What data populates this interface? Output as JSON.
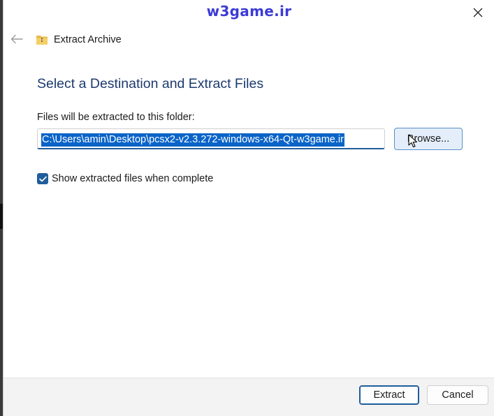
{
  "watermark": "w3game.ir",
  "dialog": {
    "title": "Extract Archive",
    "heading": "Select a Destination and Extract Files",
    "destination_label": "Files will be extracted to this folder:",
    "destination_path": "C:\\Users\\amin\\Desktop\\pcsx2-v2.3.272-windows-x64-Qt-w3game.ir",
    "browse_label": "Browse...",
    "show_files_label": "Show extracted files when complete",
    "show_files_checked": true
  },
  "footer": {
    "extract_label": "Extract",
    "cancel_label": "Cancel"
  },
  "icons": {
    "close": "close-icon",
    "back": "back-arrow-icon",
    "folder": "zip-folder-icon",
    "check": "checkmark-icon",
    "cursor": "mouse-cursor-icon"
  },
  "colors": {
    "accent": "#1f5d9c",
    "heading": "#1c3a6e",
    "selection": "#0a64c8",
    "watermark": "#3b3bd6",
    "browse_hover_bg": "#e4eefa",
    "footer_bg": "#f3f3f3"
  }
}
